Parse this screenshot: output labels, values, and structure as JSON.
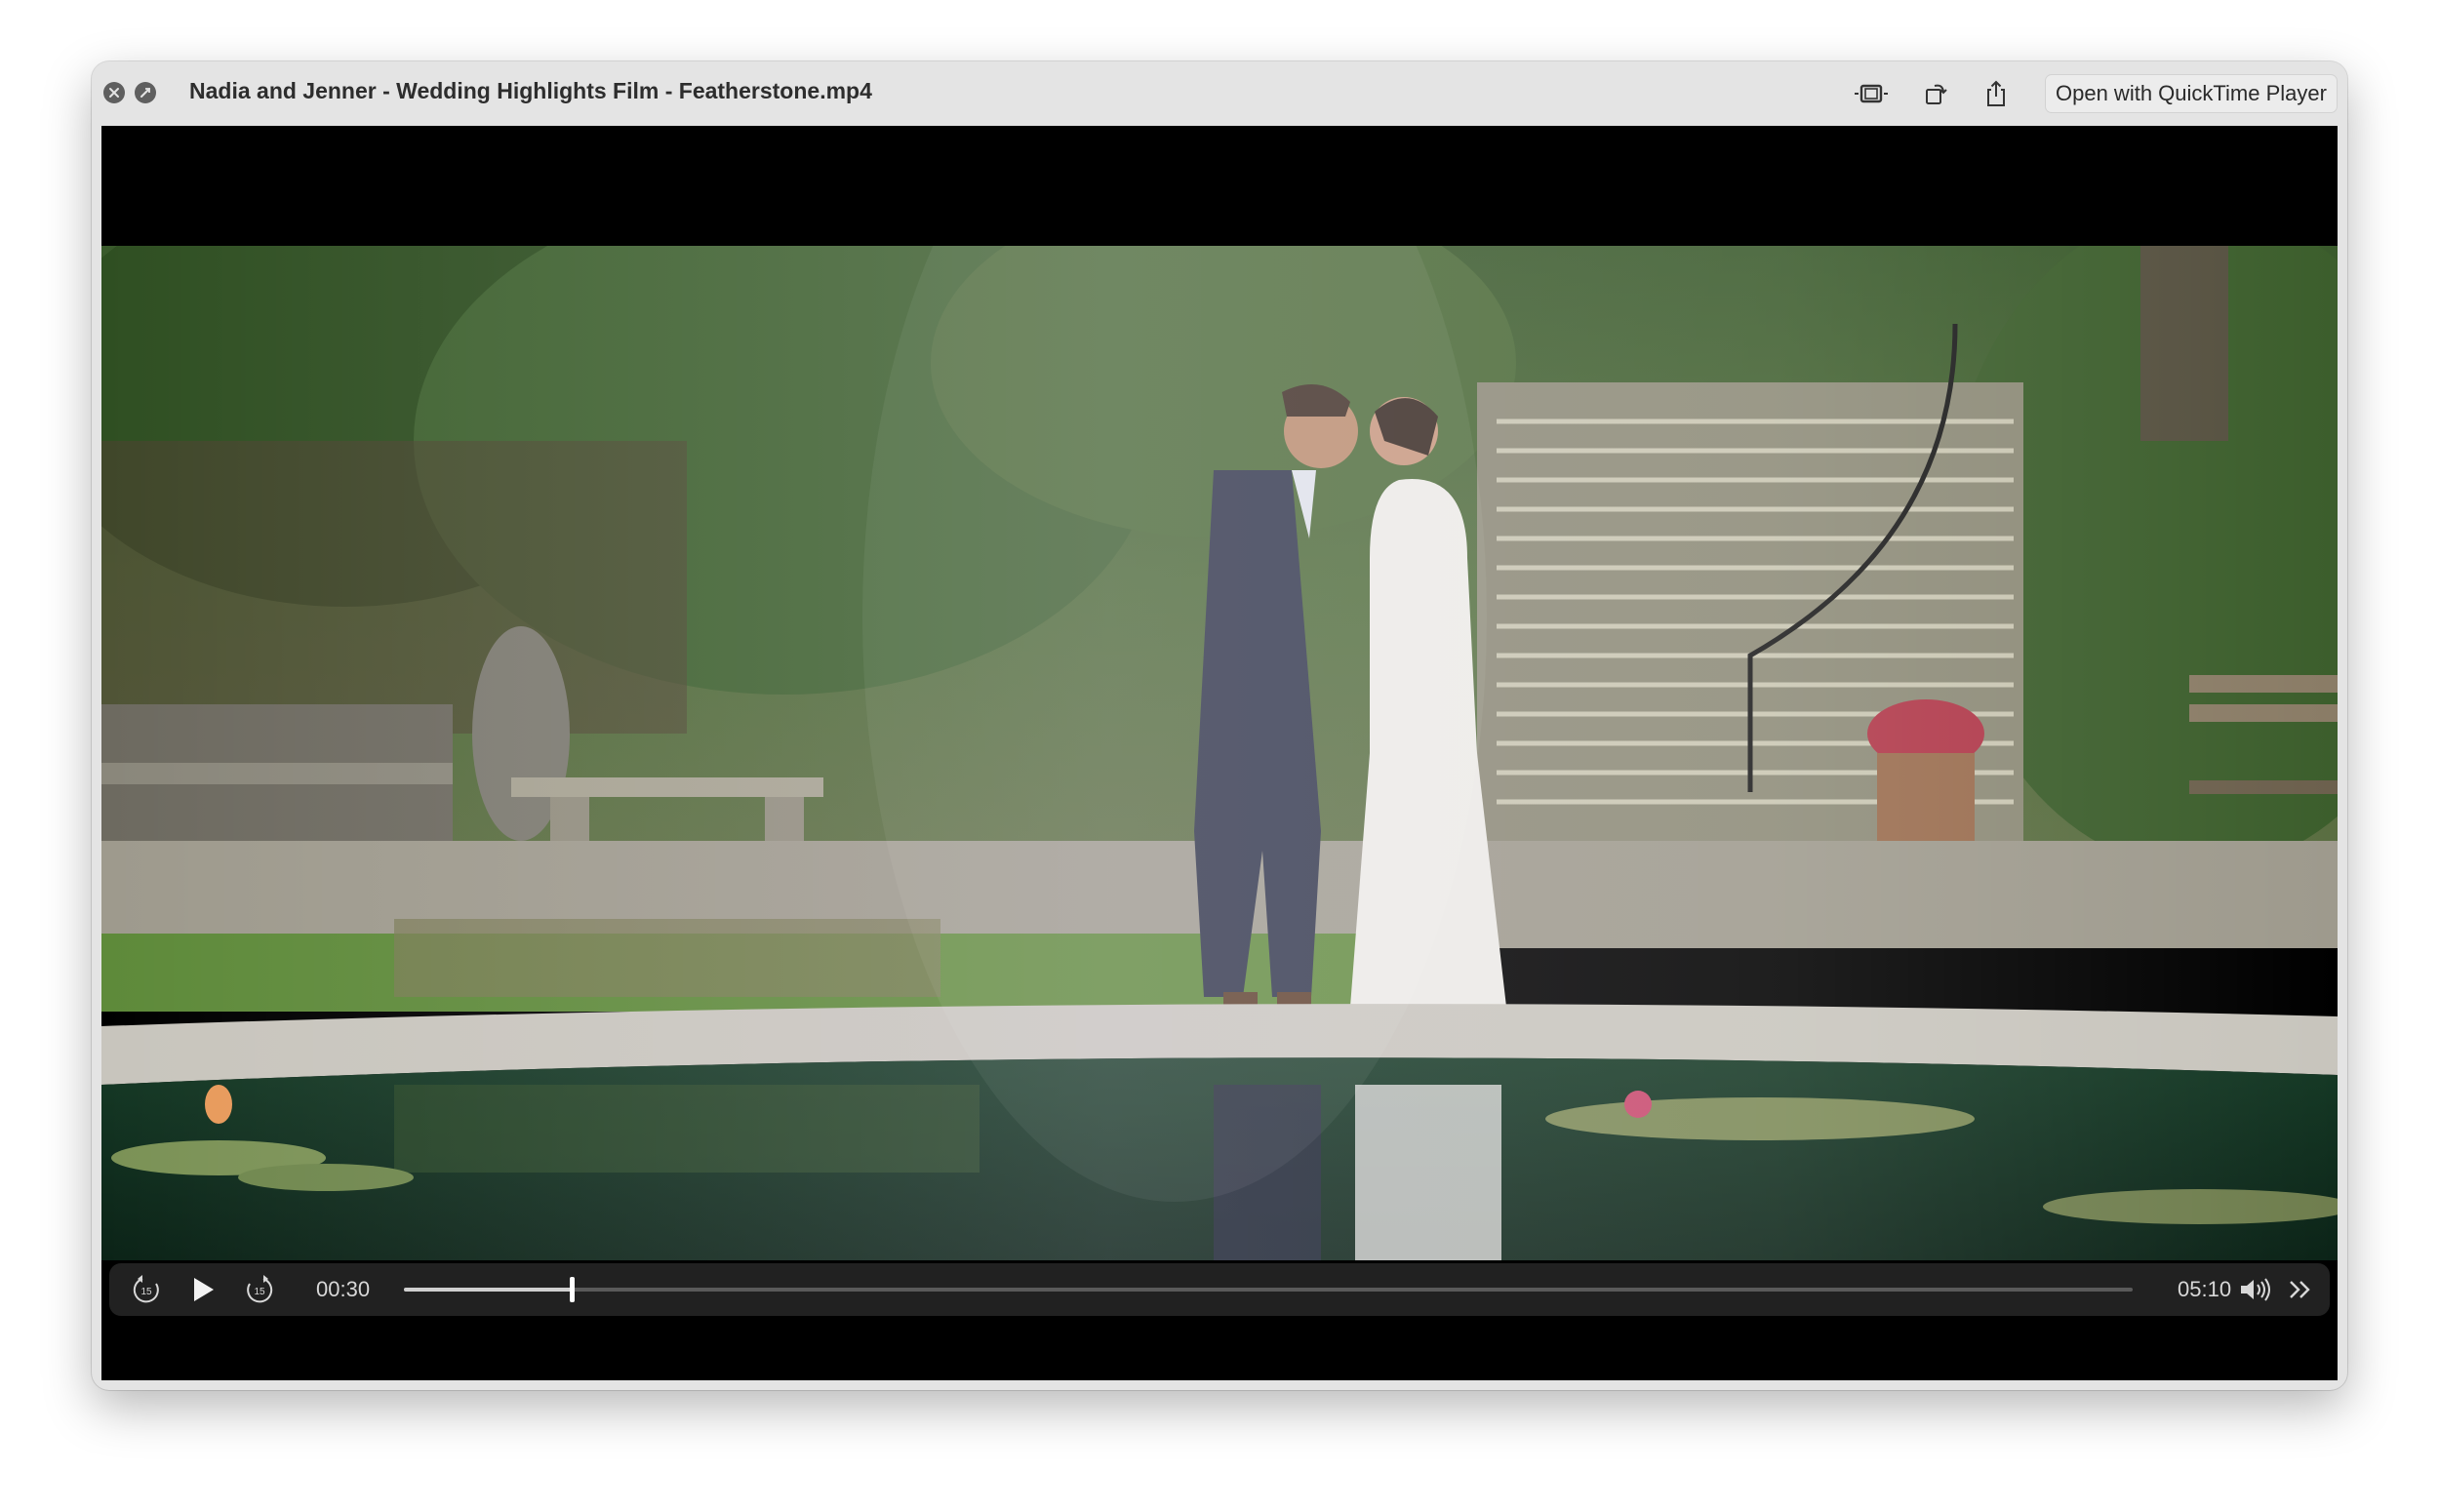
{
  "window": {
    "title": "Nadia and Jenner - Wedding Highlights Film - Featherstone.mp4",
    "open_with_label": "Open with QuickTime Player"
  },
  "toolbar_icons": [
    "trim-icon",
    "rotate-icon",
    "share-icon"
  ],
  "player": {
    "current_time": "00:30",
    "total_time": "05:10",
    "progress_fraction": 0.097,
    "skip_back_seconds": "15",
    "skip_forward_seconds": "15"
  },
  "colors": {
    "window_bg": "#e4e4e4",
    "video_bg": "#000000",
    "controls_bg": "#222222"
  }
}
